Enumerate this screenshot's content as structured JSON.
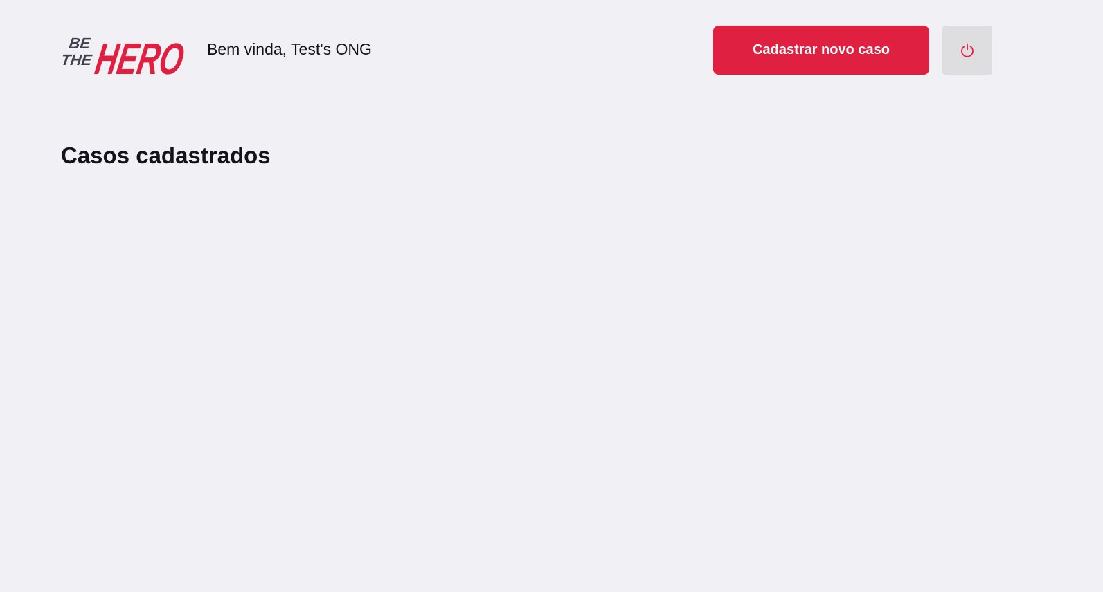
{
  "header": {
    "logo": {
      "alt": "Be The Hero",
      "icon": "be-the-hero-logo",
      "colors": {
        "dark": "#41414d",
        "accent": "#e02041"
      }
    },
    "welcome_text": "Bem vinda, Test's ONG",
    "new_case_label": "Cadastrar novo caso",
    "logout_icon": "power-icon"
  },
  "main": {
    "title": "Casos cadastrados",
    "cases": []
  },
  "colors": {
    "background": "#f0f0f5",
    "primary": "#e02041",
    "text": "#13131a",
    "secondary_button": "#dedee0"
  }
}
